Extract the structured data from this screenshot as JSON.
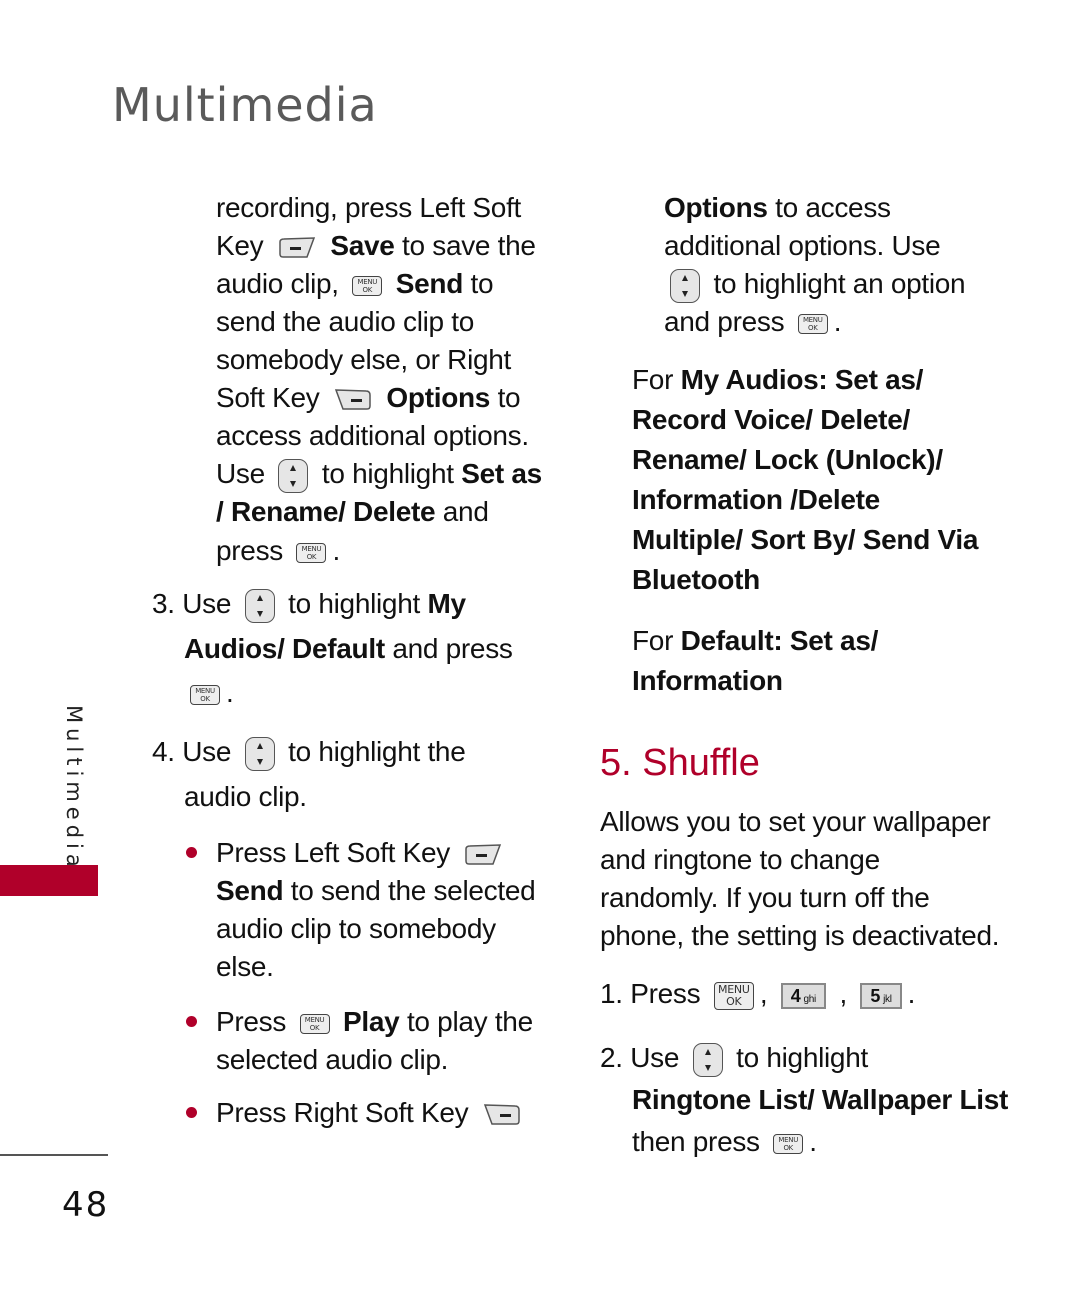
{
  "header": {
    "title": "Multimedia"
  },
  "side_tab": {
    "label": "Multimedia",
    "accent_color": "#b0002a"
  },
  "footer": {
    "page_number": "48"
  },
  "left_column": {
    "continuation": {
      "l1": "recording, press Left Soft",
      "l2a": "Key",
      "l2b": "Save",
      "l2c": "to save the",
      "l3a": "audio clip,",
      "l3b": "Send",
      "l3c": "to",
      "l4": "send the audio clip to",
      "l5": "somebody else, or Right",
      "l6a": "Soft Key",
      "l6b": "Options",
      "l6c": "to",
      "l7": "access additional options.",
      "l8a": "Use",
      "l8b": "to highlight",
      "l8c": "Set as",
      "l9a": "/ Rename/ Delete",
      "l9b": "and",
      "l10a": "press",
      "l10b": "."
    },
    "step3": {
      "num": "3.",
      "a": "Use",
      "b": "to highlight",
      "c": "My",
      "d": "Audios/ Default",
      "e": "and press",
      "f": "."
    },
    "step4": {
      "num": "4.",
      "a": "Use",
      "b": "to highlight the",
      "c": "audio clip."
    },
    "bullets": [
      {
        "a": "Press Left Soft Key",
        "b": "Send",
        "c": "to send the selected",
        "d": "audio clip to somebody",
        "e": "else."
      },
      {
        "a": "Press",
        "b": "Play",
        "c": "to play the",
        "d": "selected audio clip."
      },
      {
        "a": "Press Right Soft Key"
      }
    ]
  },
  "right_column": {
    "continuation": {
      "l1a": "Options",
      "l1b": "to access",
      "l2": "additional options. Use",
      "l3": "to highlight an option",
      "l4a": "and press",
      "l4b": "."
    },
    "my_audios_options": {
      "prefix": "For",
      "lines": [
        "My Audios: Set as/",
        "Record Voice/ Delete/",
        "Rename/ Lock (Unlock)/",
        "Information /Delete",
        "Multiple/ Sort By/ Send Via",
        "Bluetooth"
      ]
    },
    "default_options": {
      "prefix": "For",
      "l1": "Default: Set as/",
      "l2": "Information"
    },
    "section": {
      "heading": "5. Shuffle",
      "description": [
        "Allows you to set your wallpaper",
        "and ringtone to change",
        "randomly. If you turn off the",
        "phone, the setting is deactivated."
      ],
      "step1": {
        "num": "1.",
        "a": "Press",
        "sep1": ",",
        "sep2": ",",
        "end": "."
      },
      "step2": {
        "num": "2.",
        "a": "Use",
        "b": "to highlight",
        "c": "Ringtone List/ Wallpaper List",
        "d": "then press",
        "e": "."
      }
    }
  },
  "keys": {
    "ok_top": "MENU",
    "ok_bottom": "OK",
    "key4_num": "4",
    "key4_letters": "ghi",
    "key5_num": "5",
    "key5_letters": "jkl"
  },
  "icons": [
    "left-soft-key-icon",
    "right-soft-key-icon",
    "menu-ok-key-icon",
    "nav-up-down-key-icon",
    "key-4-ghi-icon",
    "key-5-jkl-icon"
  ]
}
